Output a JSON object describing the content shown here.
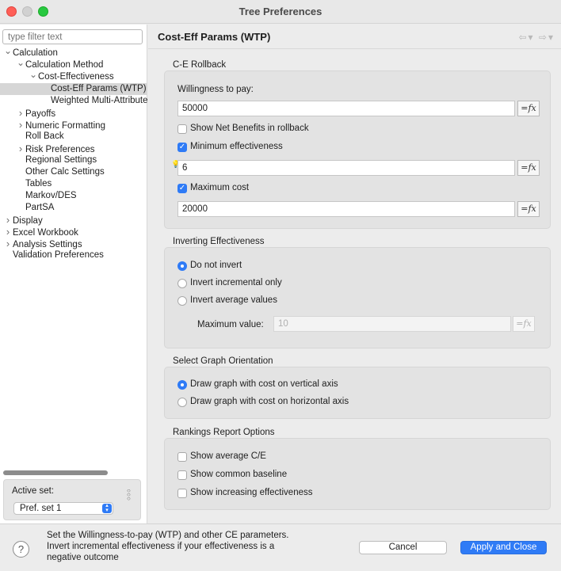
{
  "window": {
    "title": "Tree Preferences"
  },
  "sidebar": {
    "filter_placeholder": "type filter text",
    "tree": [
      {
        "label": "Calculation",
        "indent": 0,
        "arrow": "v"
      },
      {
        "label": "Calculation Method",
        "indent": 1,
        "arrow": "v"
      },
      {
        "label": "Cost-Effectiveness",
        "indent": 2,
        "arrow": "v"
      },
      {
        "label": "Cost-Eff Params (WTP)",
        "indent": 3,
        "arrow": "",
        "selected": true
      },
      {
        "label": "Weighted Multi-Attribute",
        "indent": 3,
        "arrow": ""
      },
      {
        "label": "Payoffs",
        "indent": 1,
        "arrow": ">"
      },
      {
        "label": "Numeric Formatting",
        "indent": 1,
        "arrow": ">"
      },
      {
        "label": "Roll Back",
        "indent": 1,
        "arrow": ""
      },
      {
        "label": "Risk Preferences",
        "indent": 1,
        "arrow": ">"
      },
      {
        "label": "Regional Settings",
        "indent": 1,
        "arrow": ""
      },
      {
        "label": "Other Calc Settings",
        "indent": 1,
        "arrow": ""
      },
      {
        "label": "Tables",
        "indent": 1,
        "arrow": ""
      },
      {
        "label": "Markov/DES",
        "indent": 1,
        "arrow": ""
      },
      {
        "label": "PartSA",
        "indent": 1,
        "arrow": ""
      },
      {
        "label": "Display",
        "indent": 0,
        "arrow": ">"
      },
      {
        "label": "Excel Workbook",
        "indent": 0,
        "arrow": ">"
      },
      {
        "label": "Analysis Settings",
        "indent": 0,
        "arrow": ">"
      },
      {
        "label": "Validation Preferences",
        "indent": 0,
        "arrow": ""
      }
    ],
    "active_set_label": "Active set:",
    "active_set_value": "Pref. set 1"
  },
  "pane": {
    "title": "Cost-Eff Params (WTP)",
    "ce_rollback": {
      "label": "C-E Rollback",
      "wtp_label": "Willingness to pay:",
      "wtp_value": "50000",
      "show_net_benefits": "Show Net Benefits in rollback",
      "min_eff_label": "Minimum effectiveness",
      "min_eff_value": "6",
      "max_cost_label": "Maximum cost",
      "max_cost_value": "20000"
    },
    "inverting": {
      "label": "Inverting Effectiveness",
      "options": [
        "Do not invert",
        "Invert incremental only",
        "Invert average values"
      ],
      "selected": 0,
      "max_label": "Maximum value:",
      "max_value": "10"
    },
    "graph": {
      "label": "Select Graph Orientation",
      "options": [
        "Draw graph with cost on vertical axis",
        "Draw graph with cost on horizontal axis"
      ],
      "selected": 0
    },
    "rankings": {
      "label": "Rankings Report Options",
      "options": [
        "Show average C/E",
        "Show common baseline",
        "Show increasing effectiveness"
      ]
    }
  },
  "footer": {
    "description": "Set the Willingness-to-pay (WTP) and other CE parameters. Invert incremental effectiveness if your effectiveness is a negative outcome",
    "cancel": "Cancel",
    "apply": "Apply and Close",
    "help": "?"
  },
  "fx_label": "=fx"
}
